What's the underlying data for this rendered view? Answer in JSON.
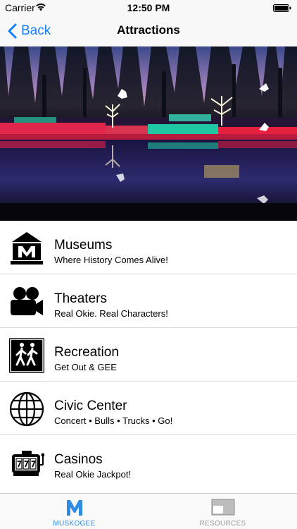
{
  "status_bar": {
    "carrier": "Carrier",
    "time": "12:50 PM",
    "wifi_icon": "wifi-icon",
    "battery_icon": "battery-icon"
  },
  "nav": {
    "back_label": "Back",
    "title": "Attractions"
  },
  "hero": {
    "icon": "christmas-lights-photo"
  },
  "list": {
    "items": [
      {
        "title": "Museums",
        "subtitle": "Where History Comes Alive!",
        "icon": "museum-icon"
      },
      {
        "title": "Theaters",
        "subtitle": "Real Okie. Real Characters!",
        "icon": "movie-camera-icon"
      },
      {
        "title": "Recreation",
        "subtitle": "Get Out & GEE",
        "icon": "hikers-icon"
      },
      {
        "title": "Civic Center",
        "subtitle": "Concert • Bulls • Trucks • Go!",
        "icon": "globe-icon"
      },
      {
        "title": "Casinos",
        "subtitle": "Real Okie Jackpot!",
        "icon": "slot-machine-icon"
      }
    ]
  },
  "tab_bar": {
    "tabs": [
      {
        "label": "MUSKOGEE",
        "icon": "muskogee-m-icon",
        "selected": true
      },
      {
        "label": "RESOURCES",
        "icon": "resources-icon",
        "selected": false
      }
    ]
  },
  "colors": {
    "accent": "#157efb",
    "tab_active": "#2f8be6",
    "tab_inactive": "#9a9a9a"
  }
}
